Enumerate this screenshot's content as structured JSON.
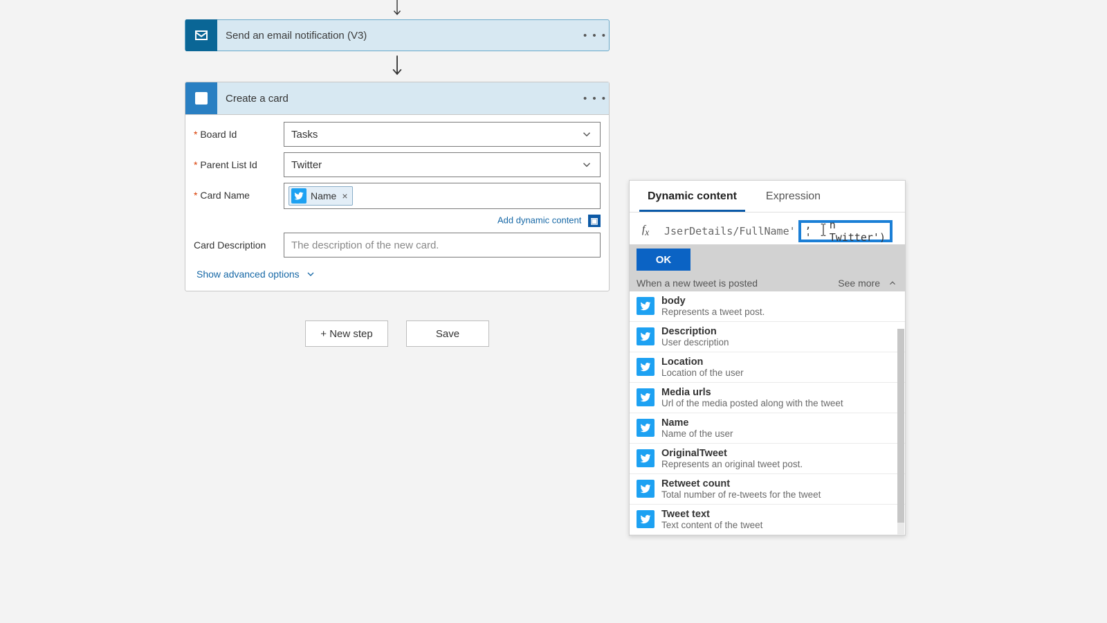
{
  "flow": {
    "email_card": {
      "title": "Send an email notification (V3)"
    },
    "trello_card": {
      "title": "Create a card",
      "fields": {
        "board_label": "Board Id",
        "board_value": "Tasks",
        "list_label": "Parent List Id",
        "list_value": "Twitter",
        "name_label": "Card Name",
        "name_token": "Name",
        "desc_label": "Card Description",
        "desc_placeholder": "The description of the new card."
      },
      "add_dynamic": "Add dynamic content",
      "advanced": "Show advanced options"
    },
    "buttons": {
      "new_step": "+ New step",
      "save": "Save"
    }
  },
  "popout": {
    "tab_dynamic": "Dynamic content",
    "tab_expression": "Expression",
    "fx_prefix": "JserDetails/FullName'",
    "fx_mid_before": ", '",
    "fx_mid_after": "n Twitter')",
    "ok": "OK",
    "section": "When a new tweet is posted",
    "see_more": "See more",
    "items": [
      {
        "t": "body",
        "d": "Represents a tweet post."
      },
      {
        "t": "Description",
        "d": "User description"
      },
      {
        "t": "Location",
        "d": "Location of the user"
      },
      {
        "t": "Media urls",
        "d": "Url of the media posted along with the tweet"
      },
      {
        "t": "Name",
        "d": "Name of the user"
      },
      {
        "t": "OriginalTweet",
        "d": "Represents an original tweet post."
      },
      {
        "t": "Retweet count",
        "d": "Total number of re-tweets for the tweet"
      },
      {
        "t": "Tweet text",
        "d": "Text content of the tweet"
      }
    ]
  }
}
